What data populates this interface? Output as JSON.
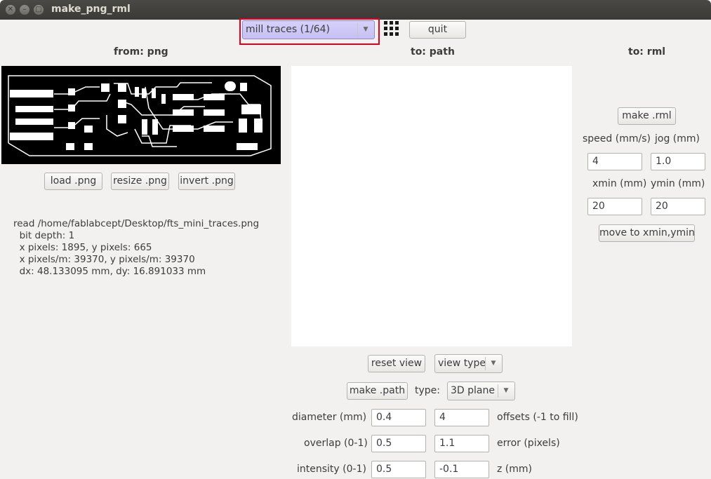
{
  "window": {
    "title": "make_png_rml"
  },
  "toolbar": {
    "process_selected": "mill traces (1/64)",
    "quit_label": "quit",
    "grid_icon": "grid-icon"
  },
  "headers": {
    "from_png": "from: png",
    "to_path": "to: path",
    "to_rml": "to: rml"
  },
  "png_panel": {
    "load_label": "load .png",
    "resize_label": "resize .png",
    "invert_label": "invert .png",
    "info_lines": [
      "read /home/fablabcept/Desktop/fts_mini_traces.png",
      "  bit depth: 1",
      "  x pixels: 1895, y pixels: 665",
      "  x pixels/m: 39370, y pixels/m: 39370",
      "  dx: 48.133095 mm, dy: 16.891033 mm"
    ]
  },
  "path_panel": {
    "reset_view_label": "reset view",
    "view_type_label": "view type",
    "make_path_label": "make .path",
    "type_label": "type:",
    "type_value": "3D plane",
    "diameter_label": "diameter (mm)",
    "diameter_value": "0.4",
    "offsets_value": "4",
    "offsets_label": "offsets (-1 to fill)",
    "overlap_label": "overlap (0-1)",
    "overlap_value": "0.5",
    "error_value": "1.1",
    "error_label": "error (pixels)",
    "intensity_label": "intensity (0-1)",
    "intensity_value": "0.5",
    "z_value": "-0.1",
    "z_label": "z (mm)"
  },
  "rml_panel": {
    "make_rml_label": "make .rml",
    "speed_label": "speed (mm/s)",
    "jog_label": "jog (mm)",
    "speed_value": "4",
    "jog_value": "1.0",
    "xmin_label": "xmin (mm)",
    "ymin_label": "ymin (mm)",
    "xmin_value": "20",
    "ymin_value": "20",
    "move_label": "move to xmin,ymin"
  },
  "colors": {
    "highlight": "#e0001b",
    "combo_selected": "#cfcaf7"
  }
}
